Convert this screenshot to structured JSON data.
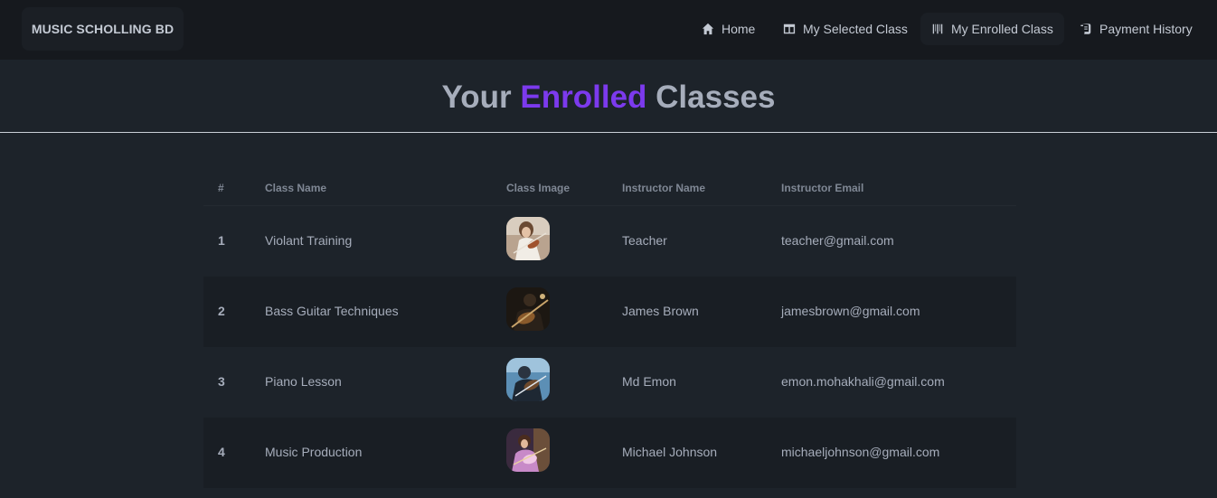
{
  "brand": "MUSIC SCHOLLING BD",
  "nav": {
    "home": "Home",
    "selected": "My Selected Class",
    "enrolled": "My Enrolled Class",
    "payment": "Payment History"
  },
  "heading": {
    "part1": "Your",
    "accent": "Enrolled",
    "part2": "Classes"
  },
  "colors": {
    "accent": "#7c3aed",
    "background": "#1d232a",
    "navbar": "#16191e"
  },
  "table": {
    "columns": [
      "#",
      "Class Name",
      "Class Image",
      "Instructor Name",
      "Instructor Email"
    ],
    "rows": [
      {
        "num": "1",
        "class_name": "Violant Training",
        "image": "violin-class-thumbnail",
        "instructor": "Teacher",
        "email": "teacher@gmail.com"
      },
      {
        "num": "2",
        "class_name": "Bass Guitar Techniques",
        "image": "bass-guitar-class-thumbnail",
        "instructor": "James Brown",
        "email": "jamesbrown@gmail.com"
      },
      {
        "num": "3",
        "class_name": "Piano Lesson",
        "image": "piano-class-thumbnail",
        "instructor": "Md Emon",
        "email": "emon.mohakhali@gmail.com"
      },
      {
        "num": "4",
        "class_name": "Music Production",
        "image": "music-production-class-thumbnail",
        "instructor": "Michael Johnson",
        "email": "michaeljohnson@gmail.com"
      }
    ]
  }
}
